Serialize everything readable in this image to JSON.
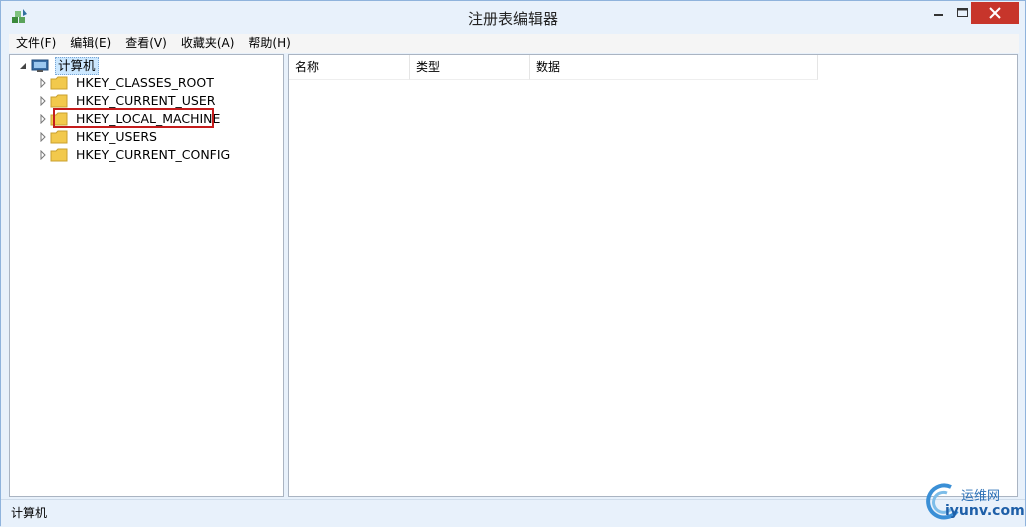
{
  "window": {
    "title": "注册表编辑器"
  },
  "menubar": {
    "items": [
      "文件(F)",
      "编辑(E)",
      "查看(V)",
      "收藏夹(A)",
      "帮助(H)"
    ]
  },
  "tree": {
    "root": {
      "label": "计算机",
      "expanded": true
    },
    "children": [
      {
        "label": "HKEY_CLASSES_ROOT"
      },
      {
        "label": "HKEY_CURRENT_USER"
      },
      {
        "label": "HKEY_LOCAL_MACHINE",
        "highlighted": true
      },
      {
        "label": "HKEY_USERS"
      },
      {
        "label": "HKEY_CURRENT_CONFIG"
      }
    ]
  },
  "list": {
    "columns": [
      "名称",
      "类型",
      "数据"
    ]
  },
  "statusbar": {
    "text": "计算机"
  },
  "watermark": {
    "line1": "运维网",
    "line2": "iyunv.com"
  },
  "colors": {
    "titlebar_bg": "#e8f1fb",
    "close_button": "#c7352b",
    "selection_box": "#c41c1c",
    "folder_yellow": "#f2c94c"
  }
}
